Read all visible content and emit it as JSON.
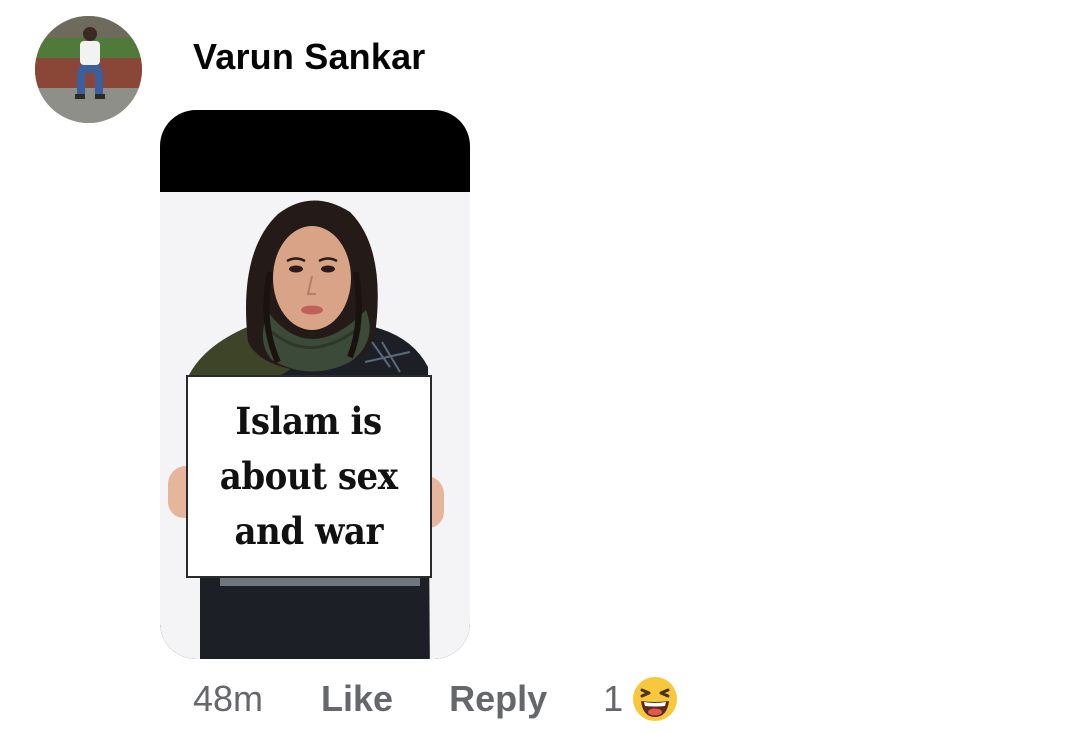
{
  "comment": {
    "author": "Varun Sankar",
    "attachment": {
      "sign_lines": [
        "Islam is",
        "about sex",
        "and war"
      ]
    },
    "timestamp": "48m",
    "like_label": "Like",
    "reply_label": "Reply",
    "reaction_count": "1",
    "reaction_icon": "laughing-face-icon"
  },
  "colors": {
    "text_primary": "#050505",
    "text_secondary": "#65676b",
    "background": "#ffffff",
    "reaction_yellow": "#f7c83c"
  }
}
